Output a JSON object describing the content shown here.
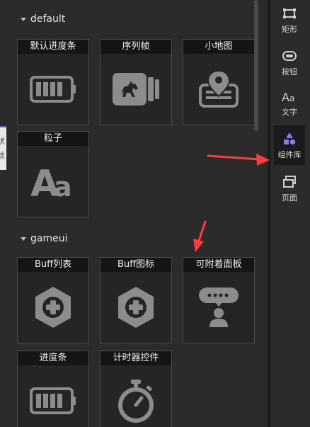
{
  "sections": [
    {
      "title": "default",
      "items": [
        {
          "label": "默认进度条",
          "icon": "progress-bar-icon"
        },
        {
          "label": "序列帧",
          "icon": "frame-sequence-icon"
        },
        {
          "label": "小地图",
          "icon": "minimap-icon"
        },
        {
          "label": "粒子",
          "icon": "text-aa-icon"
        }
      ]
    },
    {
      "title": "gameui",
      "items": [
        {
          "label": "Buff列表",
          "icon": "hexagon-plus-icon"
        },
        {
          "label": "Buff图标",
          "icon": "hexagon-plus-icon"
        },
        {
          "label": "可附着面板",
          "icon": "avatar-bubble-icon"
        },
        {
          "label": "进度条",
          "icon": "progress-bar-icon"
        },
        {
          "label": "计时器控件",
          "icon": "stopwatch-icon"
        }
      ]
    }
  ],
  "rail": [
    {
      "label": "矩形",
      "icon": "rectangle-icon"
    },
    {
      "label": "按钮",
      "icon": "button-icon"
    },
    {
      "label": "文字",
      "icon": "text-aa-icon"
    },
    {
      "label": "组件库",
      "icon": "shapes-icon",
      "active": true
    },
    {
      "label": "页面",
      "icon": "pages-icon"
    }
  ],
  "left_tab_text": "状\n丝",
  "colors": {
    "accent": "#6c5ce7",
    "annotation": "#ff3b3b",
    "icon": "#8c8c8c"
  }
}
